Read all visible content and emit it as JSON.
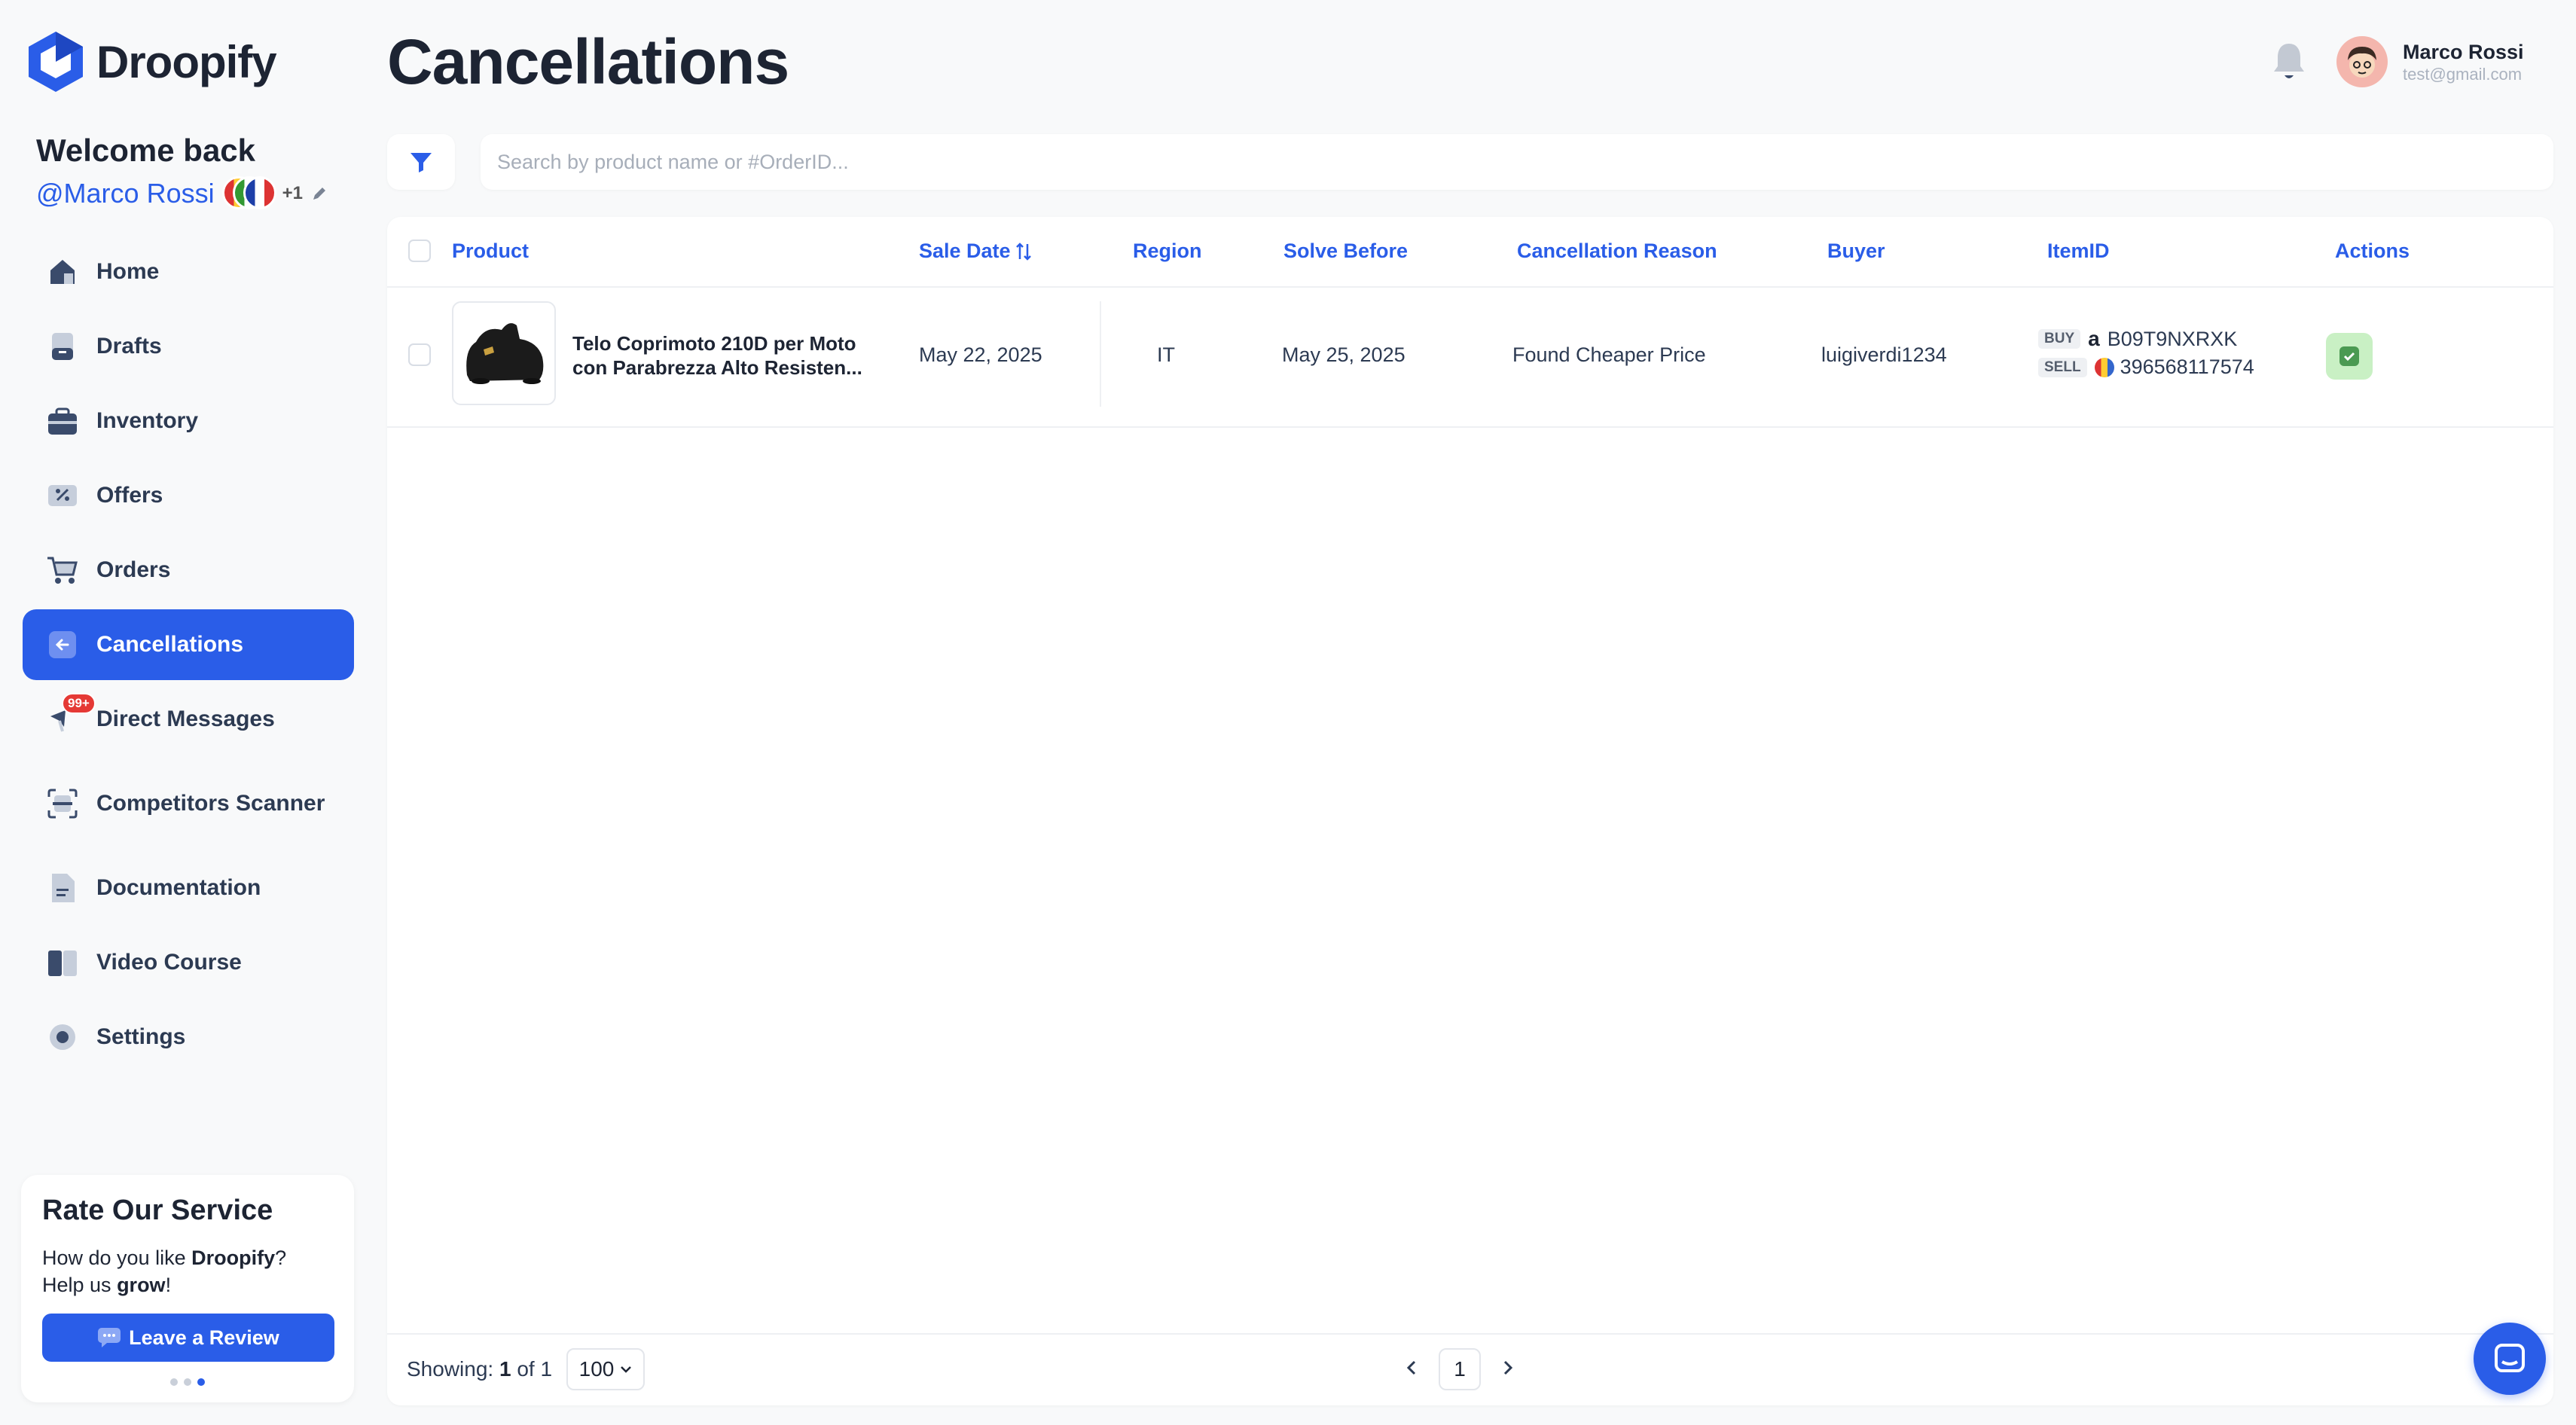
{
  "app": {
    "name": "Droopify"
  },
  "sidebar": {
    "welcome": "Welcome back",
    "handle": "@Marco Rossi",
    "extra_count": "+1",
    "items": [
      {
        "label": "Home",
        "icon": "home-icon",
        "active": false
      },
      {
        "label": "Drafts",
        "icon": "drafts-icon",
        "active": false
      },
      {
        "label": "Inventory",
        "icon": "inventory-icon",
        "active": false
      },
      {
        "label": "Offers",
        "icon": "offers-icon",
        "active": false
      },
      {
        "label": "Orders",
        "icon": "cart-icon",
        "active": false
      },
      {
        "label": "Cancellations",
        "icon": "arrow-left-icon",
        "active": true
      },
      {
        "label": "Direct Messages",
        "icon": "messages-icon",
        "active": false,
        "badge": "99+"
      },
      {
        "label": "Competitors Scanner",
        "icon": "scanner-icon",
        "active": false
      },
      {
        "label": "Documentation",
        "icon": "document-icon",
        "active": false
      },
      {
        "label": "Video Course",
        "icon": "book-icon",
        "active": false
      },
      {
        "label": "Settings",
        "icon": "gear-icon",
        "active": false
      }
    ]
  },
  "rate": {
    "title": "Rate Our Service",
    "line1_pre": "How do you like ",
    "line1_brand": "Droopify",
    "line1_post": "?",
    "line2_pre": "Help us ",
    "line2_bold": "grow",
    "line2_post": "!",
    "button": "Leave a Review"
  },
  "header": {
    "title": "Cancellations",
    "user_name": "Marco Rossi",
    "user_email": "test@gmail.com"
  },
  "search": {
    "placeholder": "Search by product name or #OrderID..."
  },
  "table": {
    "columns": {
      "product": "Product",
      "sale_date": "Sale Date",
      "region": "Region",
      "solve_before": "Solve Before",
      "reason": "Cancellation Reason",
      "buyer": "Buyer",
      "item_id": "ItemID",
      "actions": "Actions"
    },
    "rows": [
      {
        "product_line1": "Telo Coprimoto 210D per Moto",
        "product_line2": "con Parabrezza Alto Resisten...",
        "sale_date": "May 22, 2025",
        "region": "IT",
        "solve_before": "May 25, 2025",
        "reason": "Found Cheaper Price",
        "buyer": "luigiverdi1234",
        "buy_tag": "BUY",
        "buy_id": "B09T9NXRXK",
        "sell_tag": "SELL",
        "sell_id": "396568117574"
      }
    ]
  },
  "footer": {
    "showing_label": "Showing:",
    "showing_current": "1",
    "showing_of": "of 1",
    "per_page": "100",
    "page": "1"
  },
  "colors": {
    "accent": "#2a5de8",
    "action_bg": "#c9f0c4",
    "badge": "#e53935"
  }
}
